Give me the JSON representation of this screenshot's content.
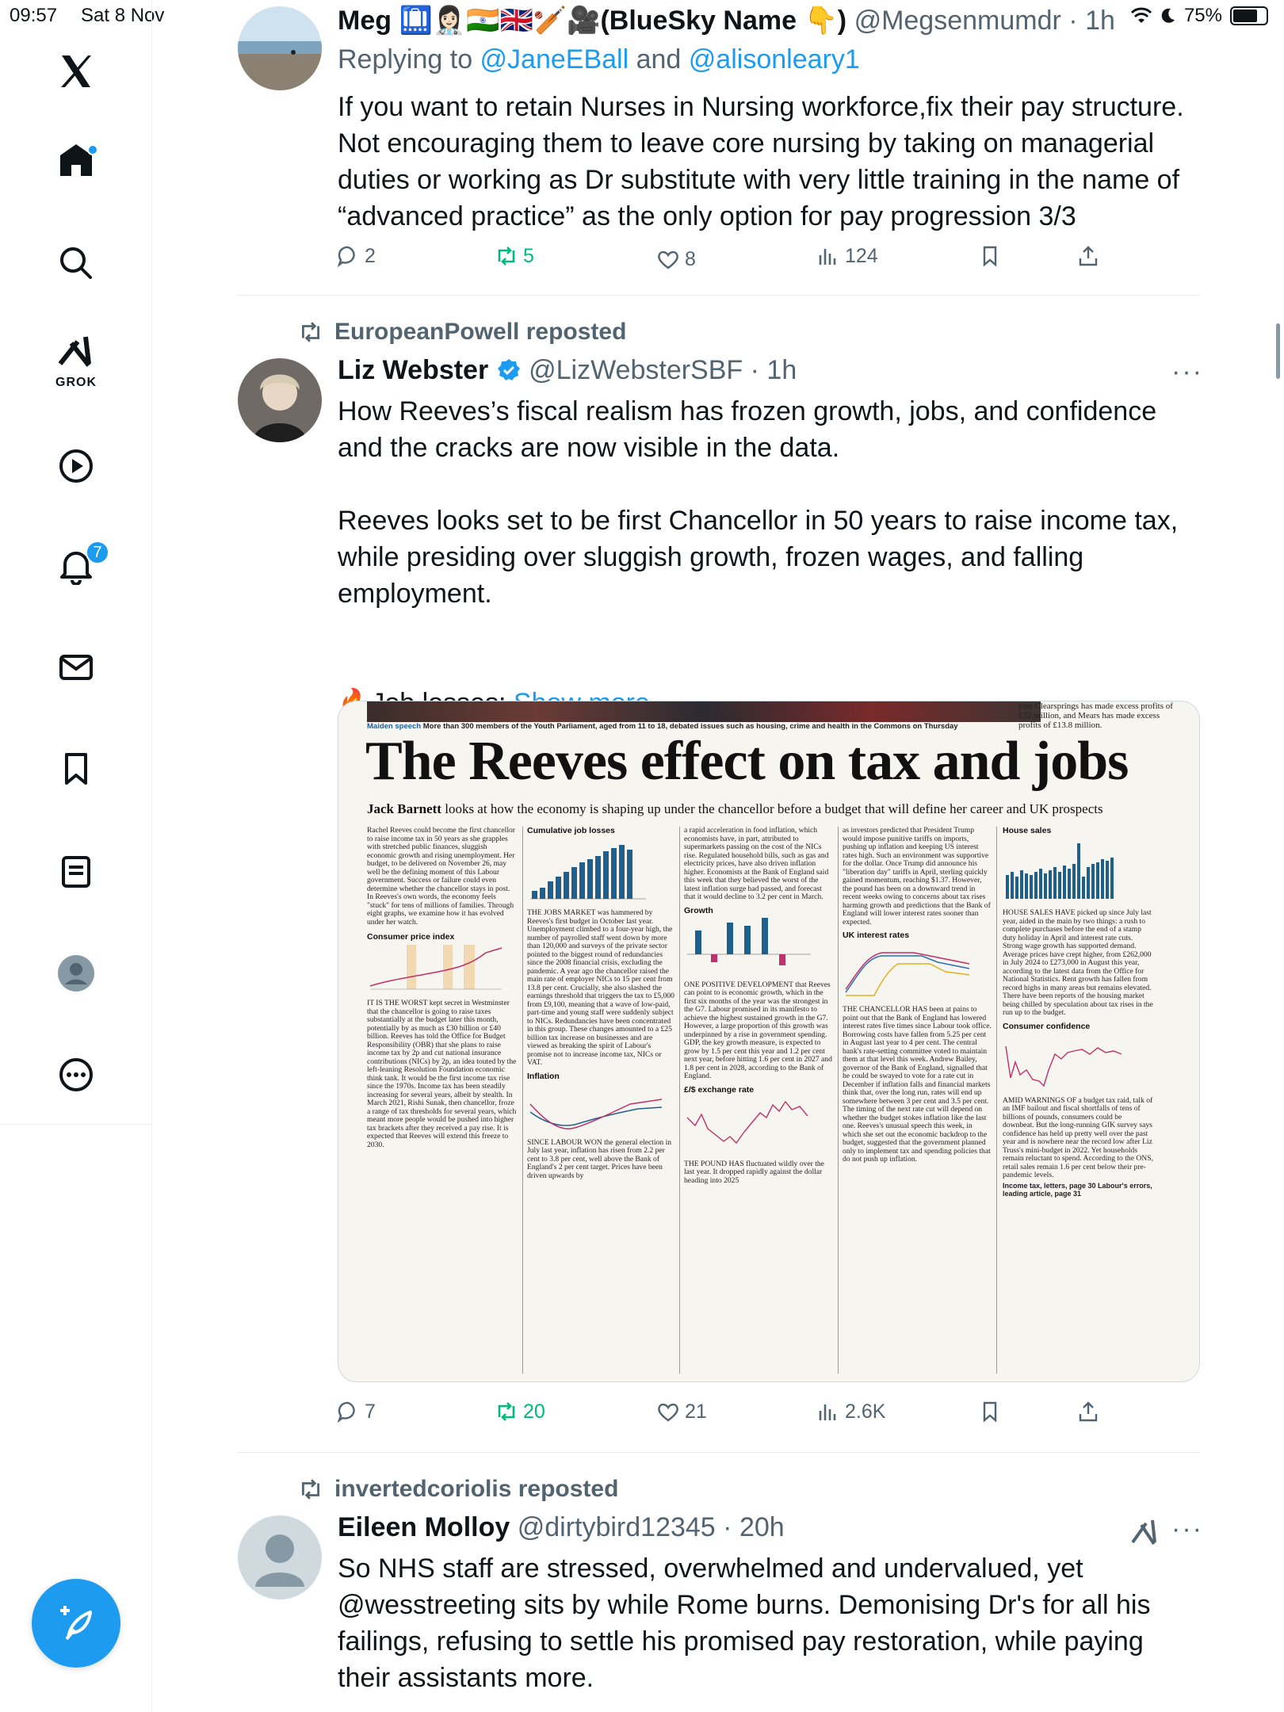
{
  "status": {
    "time": "09:57",
    "date": "Sat 8 Nov",
    "battery": "75%",
    "battery_level": 0.75
  },
  "sidebar": {
    "notifications_badge": "7",
    "grok_label": "GROK",
    "icons": [
      "x-logo-icon",
      "home-icon",
      "search-icon",
      "grok-icon",
      "video-icon",
      "bell-icon",
      "mail-icon",
      "bookmark-icon",
      "list-icon",
      "profile-icon",
      "more-icon"
    ]
  },
  "tweets": [
    {
      "name": "Meg 🛄👩🏻‍⚕️🇮🇳🇬🇧🏏🎥(BlueSky Name 👇)",
      "handle": "@Megsenmumdr",
      "time": "1h",
      "replying_prefix": "Replying to ",
      "replying_to_1": "@JaneEBall",
      "replying_and": " and ",
      "replying_to_2": "@alisonleary1",
      "text": "If you want to retain Nurses in Nursing workforce,fix their pay structure. Not encouraging them to leave core nursing by taking on managerial duties or working as Dr substitute with very little training in the name of “advanced practice” as the only option for pay progression 3/3",
      "replies": "2",
      "reposts": "5",
      "likes": "8",
      "views": "124"
    },
    {
      "reposted_by": "EuropeanPowell reposted",
      "name": "Liz Webster",
      "handle": "@LizWebsterSBF",
      "time": "1h",
      "text_1": "How Reeves’s fiscal realism has frozen growth, jobs, and confidence and the cracks are now visible in the data.",
      "text_2": "Reeves looks set to be first Chancellor in 50 years to raise income tax, while presiding over sluggish growth, frozen wages, and falling employment.",
      "text_3": "🔥Job losses: ",
      "show_more": "Show more",
      "replies": "7",
      "reposts": "20",
      "likes": "21",
      "views": "2.6K",
      "article": {
        "kicker_label": "Maiden speech",
        "kicker": " More than 300 members of the Youth Parliament, aged from 11 to 18, debated issues such as housing, crime and health in the Commons on Thursday",
        "top_right": "past Clearsprings has made excess profits of £32 million, and Mears has made excess profits of £13.8 million.",
        "headline": "The Reeves effect on tax and jobs",
        "byline_name": "Jack Barnett",
        "byline_rest": " looks at how the economy is shaping up under the chancellor before a budget that will define her career and UK prospects",
        "col1": "Rachel Reeves could become the first chancellor to raise income tax in 50 years as she grapples with stretched public finances, sluggish economic growth and rising unemployment. Her budget, to be delivered on November 26, may well be the defining moment of this Labour government. Success or failure could even determine whether the chancellor stays in post. In Reeves's own words, the economy feels \"stuck\" for tens of millions of families. Through eight graphs, we examine how it has evolved under her watch.",
        "col1_chart": "Consumer price index",
        "col1_b": "IT IS THE WORST kept secret in Westminster that the chancellor is going to raise taxes substantially at the budget later this month, potentially by as much as £30 billion or £40 billion. Reeves has told the Office for Budget Responsibility (OBR) that she plans to raise income tax by 2p and cut national insurance contributions (NICs) by 2p, an idea touted by the left-leaning Resolution Foundation economic think tank. It would be the first income tax rise since the 1970s. Income tax has been steadily increasing for several years, albeit by stealth. In March 2021, Rishi Sunak, then chancellor, froze a range of tax thresholds for several years, which meant more people would be pushed into higher tax brackets after they received a pay rise. It is expected that Reeves will extend this freeze to 2030.",
        "col2_chart": "Cumulative job losses",
        "col2": "THE JOBS MARKET was hammered by Reeves's first budget in October last year. Unemployment climbed to a four-year high, the number of payrolled staff went down by more than 120,000 and surveys of the private sector pointed to the biggest round of redundancies since the 2008 financial crisis, excluding the pandemic. A year ago the chancellor raised the main rate of employer NICs to 15 per cent from 13.8 per cent. Crucially, she also slashed the earnings threshold that triggers the tax to £5,000 from £9,100, meaning that a wave of low-paid, part-time and young staff were suddenly subject to NICs. Redundancies have been concentrated in this group. These changes amounted to a £25 billion tax increase on businesses and are viewed as breaking the spirit of Labour's promise not to increase income tax, NICs or VAT.",
        "col2_chart_b": "Inflation",
        "col2_b": "SINCE LABOUR WON the general election in July last year, inflation has risen from 2.2 per cent to 3.8 per cent, well above the Bank of England's 2 per cent target. Prices have been driven upwards by",
        "col3": "a rapid acceleration in food inflation, which economists have, in part, attributed to supermarkets passing on the cost of the NICs rise. Regulated household bills, such as gas and electricity prices, have also driven inflation higher. Economists at the Bank of England said this week that they believed the worst of the latest inflation surge had passed, and forecast that it would decline to 3.2 per cent in March.",
        "col3_chart": "Growth",
        "col3_b": "ONE POSITIVE DEVELOPMENT that Reeves can point to is economic growth, which in the first six months of the year was the strongest in the G7. Labour promised in its manifesto to achieve the highest sustained growth in the G7. However, a large proportion of this growth was underpinned by a rise in government spending. GDP, the key growth measure, is expected to grow by 1.5 per cent this year and 1.2 per cent next year, before hitting 1.6 per cent in 2027 and 1.8 per cent in 2028, according to the Bank of England.",
        "col3_chart_b": "£/$ exchange rate",
        "col3_c": "THE POUND HAS fluctuated wildly over the last year. It dropped rapidly against the dollar heading into 2025",
        "col4": "as investors predicted that President Trump would impose punitive tariffs on imports, pushing up inflation and keeping US interest rates high. Such an environment was supportive for the dollar. Once Trump did announce his \"liberation day\" tariffs in April, sterling quickly gained momentum, reaching $1.37. However, the pound has been on a downward trend in recent weeks owing to concerns about tax rises harming growth and predictions that the Bank of England will lower interest rates sooner than expected.",
        "col4_chart": "UK interest rates",
        "col4_b": "THE CHANCELLOR HAS been at pains to point out that the Bank of England has lowered interest rates five times since Labour took office. Borrowing costs have fallen from 5.25 per cent in August last year to 4 per cent. The central bank's rate-setting committee voted to maintain them at that level this week. Andrew Bailey, governor of the Bank of England, signalled that he could be swayed to vote for a rate cut in December if inflation falls and financial markets think that, over the long run, rates will end up somewhere between 3 per cent and 3.5 per cent. The timing of the next rate cut will depend on whether the budget stokes inflation like the last one. Reeves's unusual speech this week, in which she set out the economic backdrop to the budget, suggested that the government planned only to implement tax and spending policies that do not push up inflation.",
        "col5_chart": "House sales",
        "col5": "HOUSE SALES HAVE picked up since July last year, aided in the main by two things: a rush to complete purchases before the end of a stamp duty holiday in April and interest rate cuts. Strong wage growth has supported demand. Average prices have crept higher, from £262,000 in July 2024 to £273,000 in August this year, according to the latest data from the Office for National Statistics. Rent growth has fallen from record highs in many areas but remains elevated. There have been reports of the housing market being chilled by speculation about tax rises in the run up to the budget.",
        "col5_chart_b": "Consumer confidence",
        "col5_b": "AMID WARNINGS OF a budget tax raid, talk of an IMF bailout and fiscal shortfalls of tens of billions of pounds, consumers could be downbeat. But the long-running GfK survey says confidence has held up pretty well over the past year and is nowhere near the record low after Liz Truss's mini-budget in 2022. Yet households remain reluctant to spend. According to the ONS, retail sales remain 1.6 per cent below their pre-pandemic levels.",
        "col5_foot": "Income tax, letters, page 30 Labour's errors, leading article, page 31"
      }
    },
    {
      "reposted_by": "invertedcoriolis reposted",
      "name": "Eileen Molloy",
      "handle": "@dirtybird12345",
      "time": "20h",
      "text": "So NHS staff are stressed, overwhelmed and undervalued, yet @wesstreeting sits by while Rome burns. Demonising Dr's for all his failings, refusing to settle his promised pay restoration, while paying their assistants more."
    }
  ],
  "colors": {
    "accent": "#1d9bf0",
    "repost_green": "#00ba7c",
    "muted": "#536471",
    "text": "#0f1419"
  }
}
